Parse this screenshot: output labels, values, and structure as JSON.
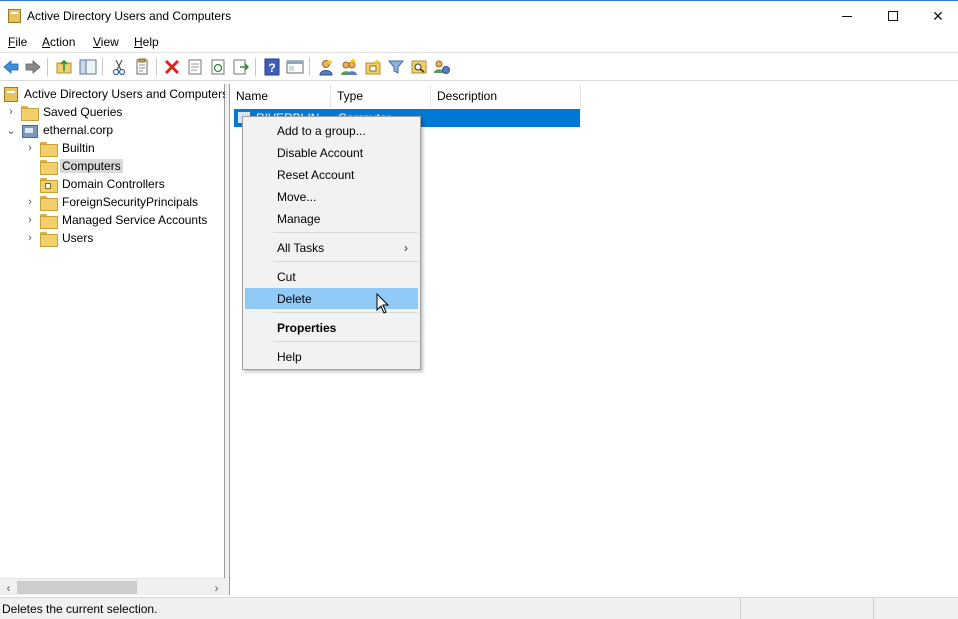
{
  "window": {
    "title": "Active Directory Users and Computers",
    "accent_color": "#0078d7"
  },
  "menubar": {
    "items": [
      {
        "label": "File",
        "mnemonic": "F"
      },
      {
        "label": "Action",
        "mnemonic": "A"
      },
      {
        "label": "View",
        "mnemonic": "V"
      },
      {
        "label": "Help",
        "mnemonic": "H"
      }
    ]
  },
  "toolbar": {
    "buttons": [
      "back-arrow-icon",
      "forward-arrow-icon",
      "up-folder-icon",
      "show-hide-tree-icon",
      "cut-icon",
      "copy-icon",
      "delete-icon",
      "properties-icon",
      "refresh-icon",
      "export-list-icon",
      "help-icon",
      "console-tree-icon",
      "create-user-icon",
      "create-group-icon",
      "create-ou-icon",
      "filter-icon",
      "find-icon",
      "add-to-group-icon"
    ]
  },
  "tree": {
    "root": "Active Directory Users and Computers",
    "items": [
      {
        "label": "Saved Queries",
        "icon": "folder-icon"
      },
      {
        "label": "ethernal.corp",
        "icon": "domain-icon"
      },
      {
        "label": "Builtin",
        "icon": "folder-icon"
      },
      {
        "label": "Computers",
        "icon": "folder-icon",
        "selected": true
      },
      {
        "label": "Domain Controllers",
        "icon": "ou-icon"
      },
      {
        "label": "ForeignSecurityPrincipals",
        "icon": "folder-icon"
      },
      {
        "label": "Managed Service Accounts",
        "icon": "folder-icon"
      },
      {
        "label": "Users",
        "icon": "folder-icon"
      }
    ]
  },
  "list": {
    "columns": [
      "Name",
      "Type",
      "Description"
    ],
    "rows": [
      {
        "name": "RIVERBLIN",
        "type": "Computer",
        "description": ""
      }
    ]
  },
  "context_menu": {
    "items": [
      {
        "label": "Add to a group..."
      },
      {
        "label": "Disable Account"
      },
      {
        "label": "Reset Account"
      },
      {
        "label": "Move..."
      },
      {
        "label": "Manage"
      },
      {
        "label": "All Tasks"
      },
      {
        "label": "Cut"
      },
      {
        "label": "Delete"
      },
      {
        "label": "Properties"
      },
      {
        "label": "Help"
      }
    ]
  },
  "statusbar": {
    "message": "Deletes the current selection."
  }
}
